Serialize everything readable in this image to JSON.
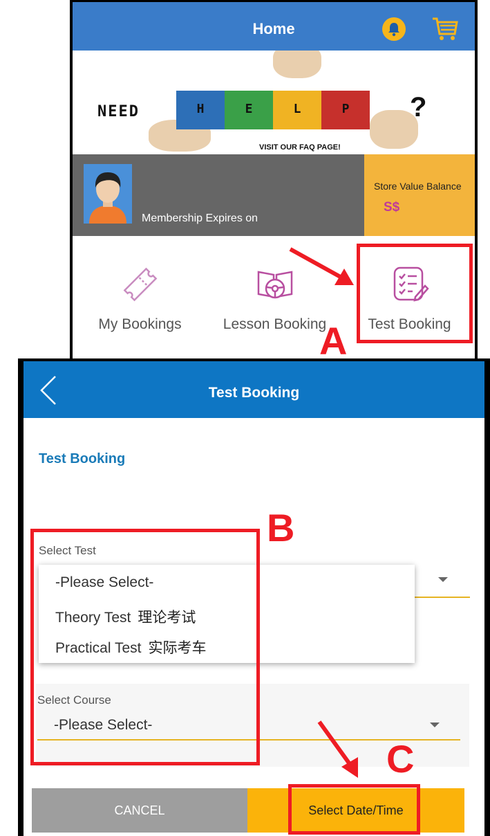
{
  "home": {
    "title": "Home",
    "banner": {
      "need": "NEED",
      "letters": [
        "H",
        "E",
        "L",
        "P"
      ],
      "question": "?",
      "visit": "VISIT OUR FAQ PAGE!"
    },
    "membership": {
      "text": "Membership Expires on"
    },
    "store": {
      "label": "Store Value Balance",
      "value": "S$"
    },
    "quick_actions": [
      {
        "label": "My Bookings",
        "icon": "ticket-icon"
      },
      {
        "label": "Lesson Booking",
        "icon": "steering-book-icon"
      },
      {
        "label": "Test Booking",
        "icon": "checklist-icon"
      }
    ]
  },
  "test_booking": {
    "title": "Test Booking",
    "heading": "Test Booking",
    "select_test": {
      "label": "Select Test",
      "options": [
        {
          "en": "-Please Select-",
          "cn": ""
        },
        {
          "en": "Theory Test",
          "cn": "理论考试"
        },
        {
          "en": "Practical Test",
          "cn": "实际考车"
        }
      ]
    },
    "select_course": {
      "label": "Select Course",
      "value": "-Please Select-"
    },
    "buttons": {
      "cancel": "CANCEL",
      "select_datetime": "Select Date/Time"
    }
  },
  "annotations": {
    "a": "A",
    "b": "B",
    "c": "C"
  },
  "colors": {
    "home_header": "#3a7cc9",
    "tb_header": "#0e76c4",
    "accent_yellow": "#fbb30a",
    "annotation_red": "#ee1c24",
    "icon_purple": "#b84fa0"
  }
}
